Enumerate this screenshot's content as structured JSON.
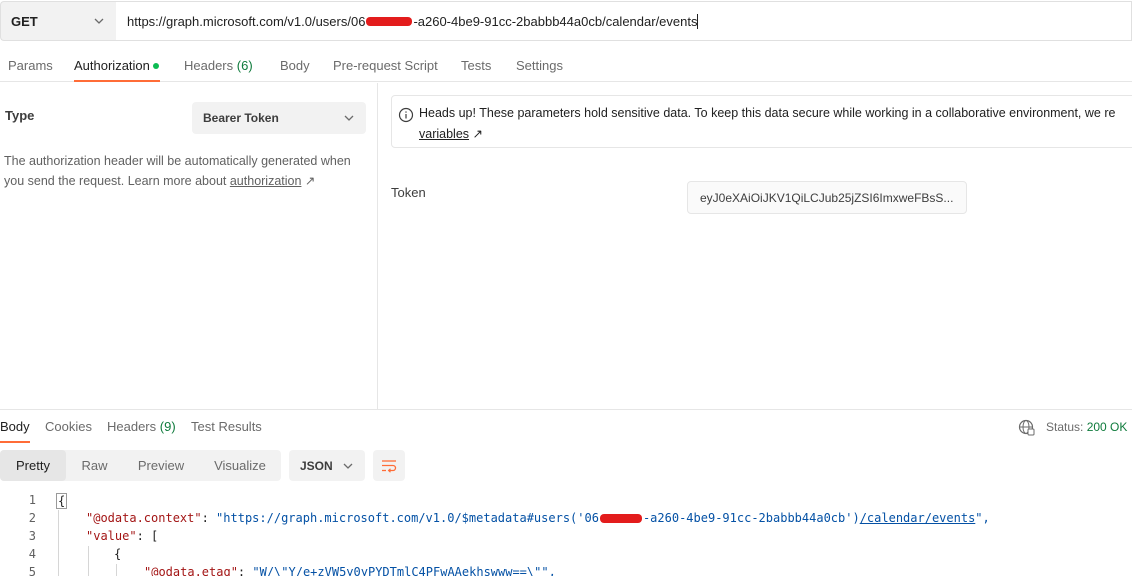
{
  "request": {
    "method": "GET",
    "url_prefix": "https://graph.microsoft.com/v1.0/users/06",
    "url_suffix": "-a260-4be9-91cc-2babbb44a0cb/calendar/events"
  },
  "request_tabs": {
    "params": "Params",
    "authorization": "Authorization",
    "headers": "Headers",
    "headers_count": "(6)",
    "body": "Body",
    "prerequest": "Pre-request Script",
    "tests": "Tests",
    "settings": "Settings"
  },
  "auth": {
    "type_label": "Type",
    "type_value": "Bearer Token",
    "description": "The authorization header will be automatically generated when you send the request. Learn more about",
    "learn_link": "authorization",
    "arrow": "↗",
    "notice_text": "Heads up! These parameters hold sensitive data. To keep this data secure while working in a collaborative environment, we re",
    "notice_link": "variables",
    "token_label": "Token",
    "token_value": "eyJ0eXAiOiJKV1QiLCJub25jZSI6ImxweFBsS..."
  },
  "response_tabs": {
    "body": "Body",
    "cookies": "Cookies",
    "headers": "Headers",
    "headers_count": "(9)",
    "test_results": "Test Results"
  },
  "status": {
    "label": "Status:",
    "value": "200 OK"
  },
  "view": {
    "pretty": "Pretty",
    "raw": "Raw",
    "preview": "Preview",
    "visualize": "Visualize",
    "format": "JSON"
  },
  "code": {
    "ln1": "1",
    "ln2": "2",
    "ln3": "3",
    "ln4": "4",
    "ln5": "5",
    "open_brace": "{",
    "l2_key": "\"@odata.context\"",
    "l2_colon": ": ",
    "l2_val_a": "\"https://graph.microsoft.com/v1.0/$metadata#users('06",
    "l2_val_b": "-a260-4be9-91cc-2babbb44a0cb')",
    "l2_link": "/calendar/events",
    "l2_end": "\",",
    "l3_key": "\"value\"",
    "l3_rest": ": [",
    "l4": "{",
    "l5_key": "\"@odata.etag\"",
    "l5_colon": ": ",
    "l5_val": "\"W/\\\"Y/e+zVW5y0yPYDTmlC4PFwAAekhswww==\\\"\","
  },
  "colors": {
    "accent": "#ff6c37",
    "status_ok": "#0f7b3c",
    "redaction": "#e31c1c"
  }
}
